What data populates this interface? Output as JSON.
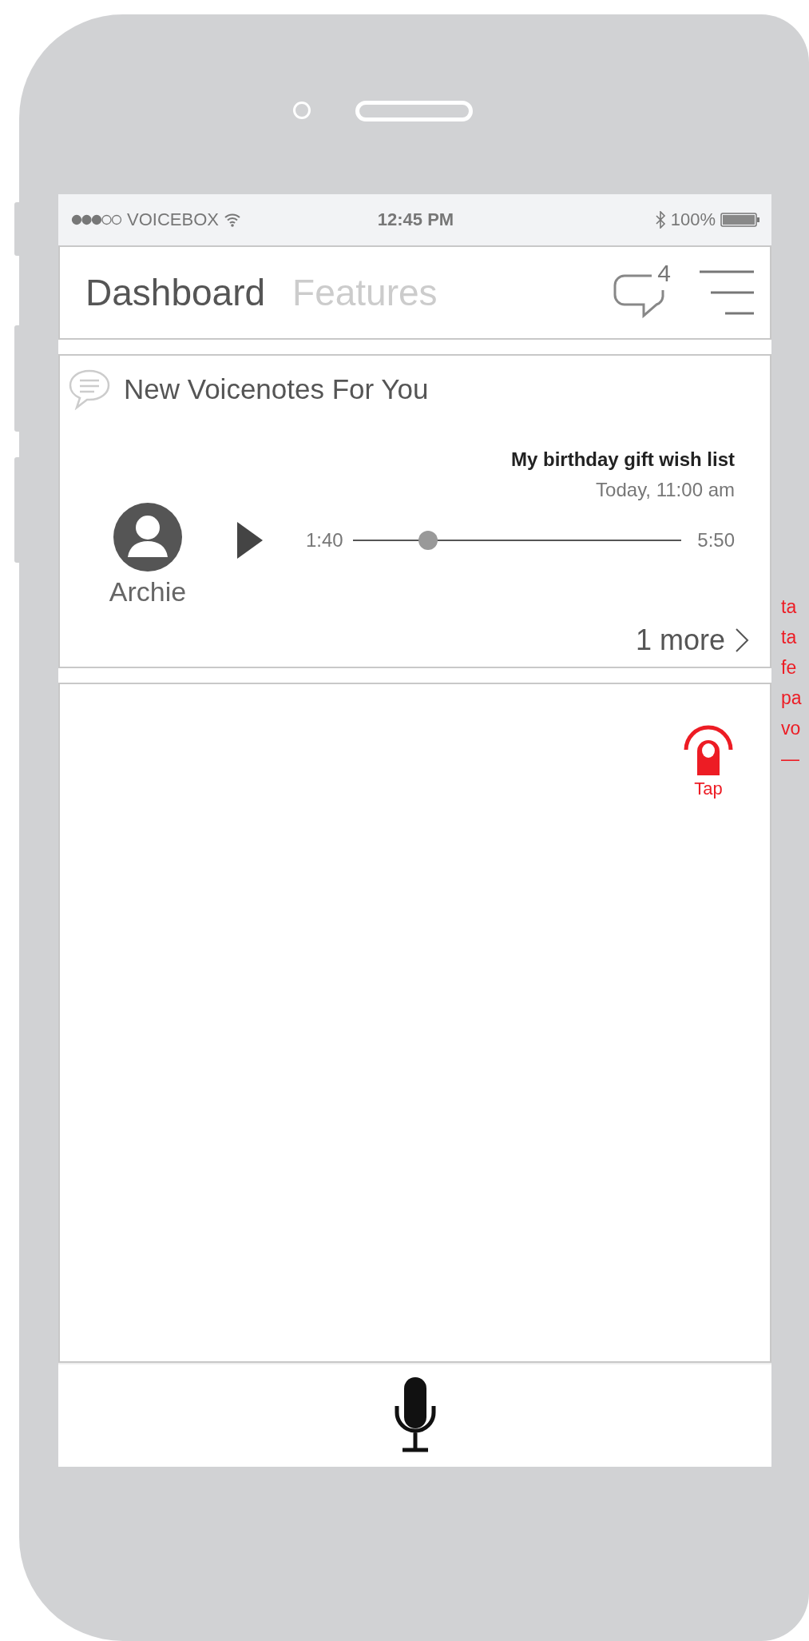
{
  "status_bar": {
    "carrier": "VOICEBOX",
    "time": "12:45 PM",
    "battery": "100%"
  },
  "header": {
    "tabs": [
      {
        "label": "Dashboard",
        "selected": true
      },
      {
        "label": "Features",
        "selected": false
      }
    ],
    "notification_count": "4"
  },
  "voicenotes": {
    "title": "New Voicenotes For You",
    "items": [
      {
        "sender": "Archie",
        "title": "My birthday gift wish list",
        "time": "Today, 11:00 am",
        "elapsed": "1:40",
        "duration": "5:50",
        "level": 0.23
      }
    ],
    "more": "1 more"
  },
  "tap_hint": {
    "label": "Tap"
  },
  "annotation": [
    "ta",
    "ta",
    "fe",
    "pa",
    "vo",
    "—"
  ]
}
